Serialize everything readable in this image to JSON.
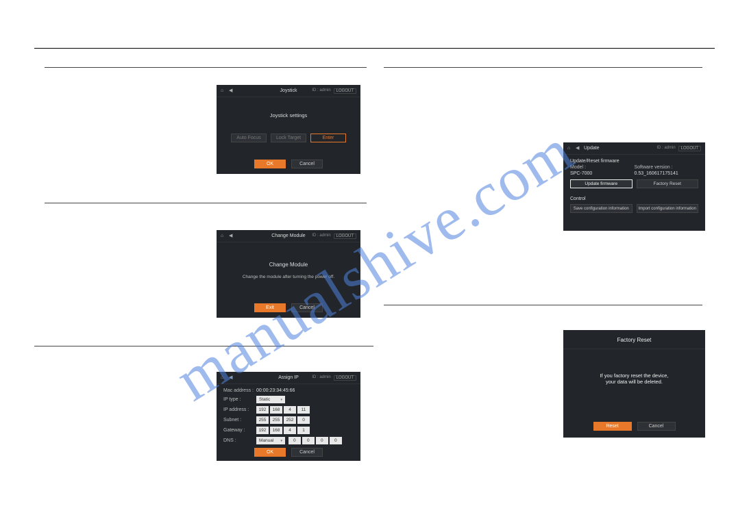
{
  "watermark": "manualshive.com",
  "header": {
    "id_label": "ID : admin",
    "logout": "LOGOUT"
  },
  "joystick": {
    "title": "Joystick",
    "heading": "Joystick settings",
    "auto_focus": "Auto Focus",
    "lock_target": "Lock Target",
    "enter": "Enter",
    "ok": "OK",
    "cancel": "Cancel"
  },
  "change_module": {
    "title": "Change Module",
    "heading": "Change Module",
    "note": "Change the module after turning the power off.",
    "exit": "Exit",
    "cancel": "Cancel"
  },
  "assign_ip": {
    "title": "Assign IP",
    "mac_label": "Mac address :",
    "mac_value": "00:00:23:34:45:66",
    "ip_type_label": "IP type :",
    "ip_type_value": "Static",
    "ip_label": "IP address :",
    "ip": [
      "192",
      "168",
      "4",
      "11"
    ],
    "subnet_label": "Subnet :",
    "subnet": [
      "255",
      "255",
      "252",
      "0"
    ],
    "gateway_label": "Gateway :",
    "gateway": [
      "192",
      "168",
      "4",
      "1"
    ],
    "dns_label": "DNS :",
    "dns_mode": "Manual",
    "dns": [
      "0",
      "0",
      "0",
      "0"
    ],
    "ok": "OK",
    "cancel": "Cancel"
  },
  "update": {
    "title": "Update",
    "section": "Update/Reset firmware",
    "model_label": "Model :",
    "model_value": "SPC-7000",
    "sw_label": "Software version :",
    "sw_value": "0.53_160617175141",
    "update_fw": "Update firmware",
    "factory_reset": "Factory Reset",
    "control": "Control",
    "save_cfg": "Save configuration information",
    "import_cfg": "Import configuration information"
  },
  "factory": {
    "title": "Factory Reset",
    "line1": "If you factory reset the device,",
    "line2": "your data will be deleted.",
    "reset": "Reset",
    "cancel": "Cancel"
  }
}
